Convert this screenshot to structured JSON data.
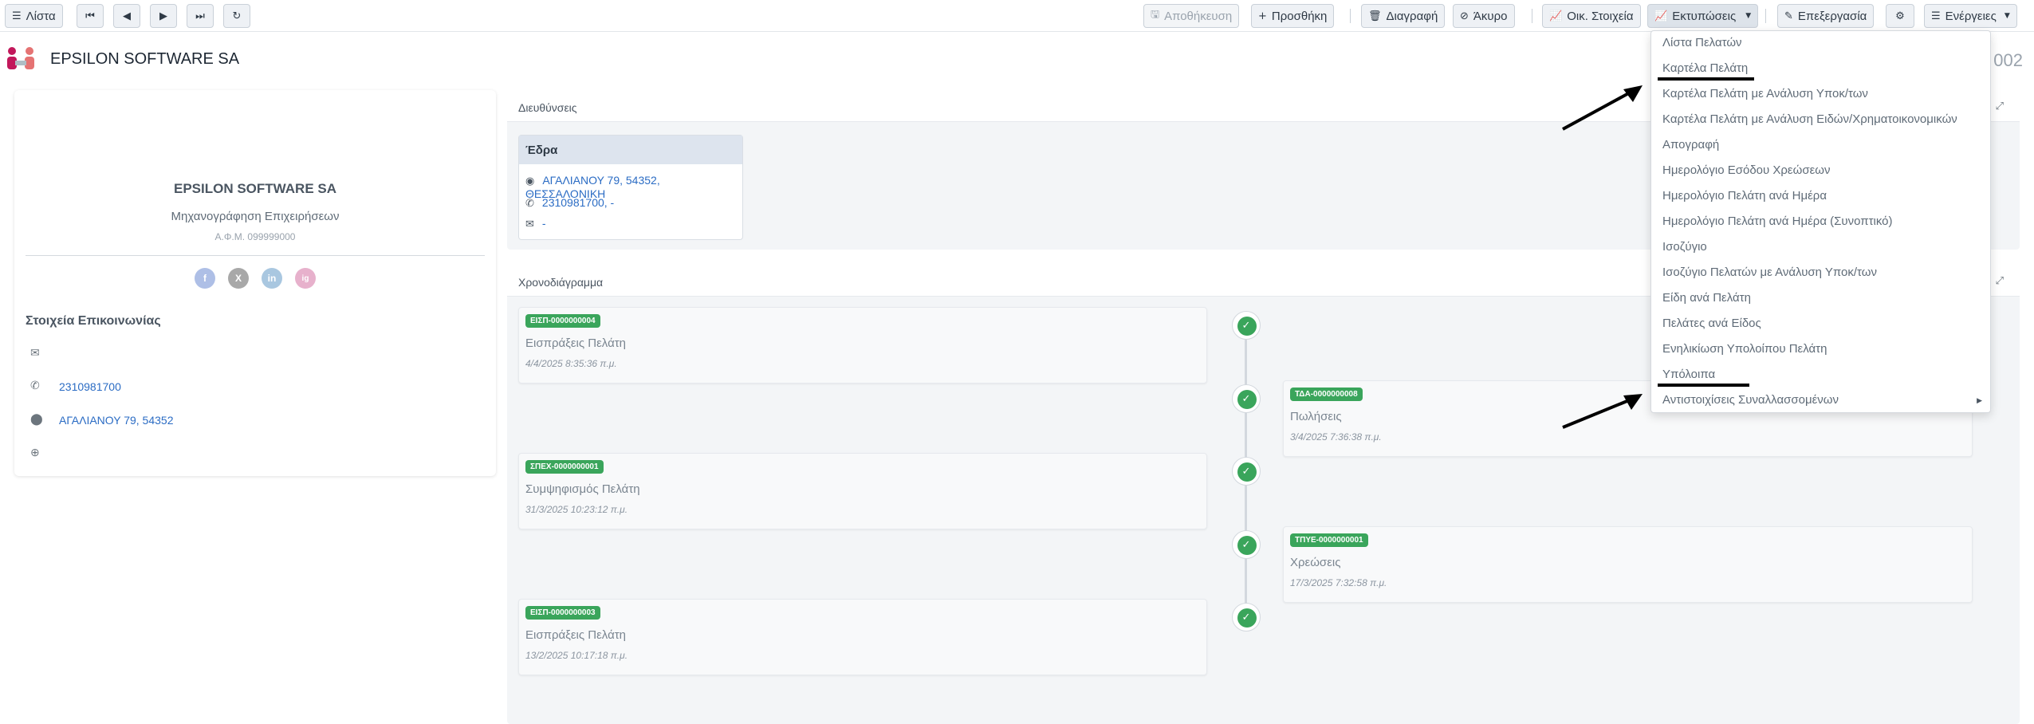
{
  "toolbar": {
    "list": "Λίστα",
    "save": "Αποθήκευση",
    "add": "Προσθήκη",
    "delete": "Διαγραφή",
    "cancel": "Άκυρο",
    "financial": "Οικ. Στοιχεία",
    "prints": "Εκτυπώσεις",
    "edit": "Επεξεργασία",
    "actions": "Ενέργειες"
  },
  "header": {
    "company": "EPSILON SOFTWARE SA",
    "record_number": "002"
  },
  "profile": {
    "name": "EPSILON SOFTWARE SA",
    "activity": "Μηχανογράφηση Επιχειρήσεων",
    "afm": "Α.Φ.Μ. 099999000",
    "socials": [
      "f",
      "X",
      "in",
      "ig"
    ],
    "contact_title": "Στοιχεία Επικοινωνίας",
    "phone": "2310981700",
    "address": "ΑΓΑΛΙΑΝΟΥ 79, 54352"
  },
  "addresses": {
    "title": "Διευθύνσεις",
    "card_title": "Έδρα",
    "address": "ΑΓΑΛΙΑΝΟΥ 79, 54352, ΘΕΣΣΑΛΟΝΙΚΗ",
    "phone": "2310981700, -",
    "email": "-"
  },
  "timeline": {
    "title": "Χρονοδιάγραμμα",
    "items": [
      {
        "badge": "ΕΙΣΠ-0000000004",
        "title": "Εισπράξεις Πελάτη",
        "date": "4/4/2025 8:35:36 π.μ."
      },
      {
        "badge": "ΤΔΑ-0000000008",
        "title": "Πωλήσεις",
        "date": "3/4/2025 7:36:38 π.μ."
      },
      {
        "badge": "ΣΠΕΧ-0000000001",
        "title": "Συμψηφισμός Πελάτη",
        "date": "31/3/2025 10:23:12 π.μ."
      },
      {
        "badge": "ΤΠΥΕ-0000000001",
        "title": "Χρεώσεις",
        "date": "17/3/2025 7:32:58 π.μ."
      },
      {
        "badge": "ΕΙΣΠ-0000000003",
        "title": "Εισπράξεις Πελάτη",
        "date": "13/2/2025 10:17:18 π.μ."
      }
    ]
  },
  "prints_menu": {
    "items": [
      "Λίστα Πελατών",
      "Καρτέλα Πελάτη",
      "Καρτέλα Πελάτη με Ανάλυση Υποκ/των",
      "Καρτέλα Πελάτη με Ανάλυση Ειδών/Χρηματοικονομικών",
      "Απογραφή",
      "Ημερολόγιο Εσόδου Χρεώσεων",
      "Ημερολόγιο Πελάτη ανά Ημέρα",
      "Ημερολόγιο Πελάτη ανά Ημέρα (Συνοπτικό)",
      "Ισοζύγιο",
      "Ισοζύγιο Πελατών με Ανάλυση Υποκ/των",
      "Είδη ανά Πελάτη",
      "Πελάτες ανά Είδος",
      "Ενηλικίωση Υπολοίπου Πελάτη",
      "Υπόλοιπα",
      "Αντιστοιχίσεις Συναλλασσομένων"
    ]
  },
  "colors": {
    "accent_green": "#3aa55b",
    "link_blue": "#2b6cc4",
    "logo_pink": "#c2185b"
  }
}
